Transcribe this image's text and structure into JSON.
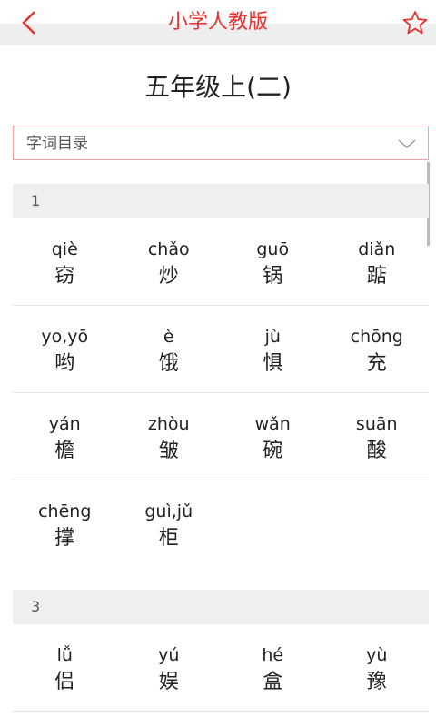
{
  "header": {
    "title": "小学人教版"
  },
  "page_title": "五年级上(二)",
  "dropdown": {
    "selected": "字词目录"
  },
  "sections": [
    {
      "label": "1",
      "rows": [
        [
          {
            "pinyin": "qiè",
            "hanzi": "窃"
          },
          {
            "pinyin": "chǎo",
            "hanzi": "炒"
          },
          {
            "pinyin": "guō",
            "hanzi": "锅"
          },
          {
            "pinyin": "diǎn",
            "hanzi": "踮"
          }
        ],
        [
          {
            "pinyin": "yo,yō",
            "hanzi": "哟"
          },
          {
            "pinyin": "è",
            "hanzi": "饿"
          },
          {
            "pinyin": "jù",
            "hanzi": "惧"
          },
          {
            "pinyin": "chōng",
            "hanzi": "充"
          }
        ],
        [
          {
            "pinyin": "yán",
            "hanzi": "檐"
          },
          {
            "pinyin": "zhòu",
            "hanzi": "皱"
          },
          {
            "pinyin": "wǎn",
            "hanzi": "碗"
          },
          {
            "pinyin": "suān",
            "hanzi": "酸"
          }
        ],
        [
          {
            "pinyin": "chēng",
            "hanzi": "撑"
          },
          {
            "pinyin": "guì,jǔ",
            "hanzi": "柜"
          }
        ]
      ]
    },
    {
      "label": "3",
      "rows": [
        [
          {
            "pinyin": "lǚ",
            "hanzi": "侣"
          },
          {
            "pinyin": "yú",
            "hanzi": "娱"
          },
          {
            "pinyin": "hé",
            "hanzi": "盒"
          },
          {
            "pinyin": "yù",
            "hanzi": "豫"
          }
        ]
      ]
    }
  ],
  "colors": {
    "accent": "#e8302c",
    "section_bg": "#efefef",
    "divider": "#e4e4e4"
  },
  "icons": {
    "back": "chevron-left-icon",
    "favorite": "star-outline-icon",
    "dropdown": "chevron-down-icon"
  }
}
